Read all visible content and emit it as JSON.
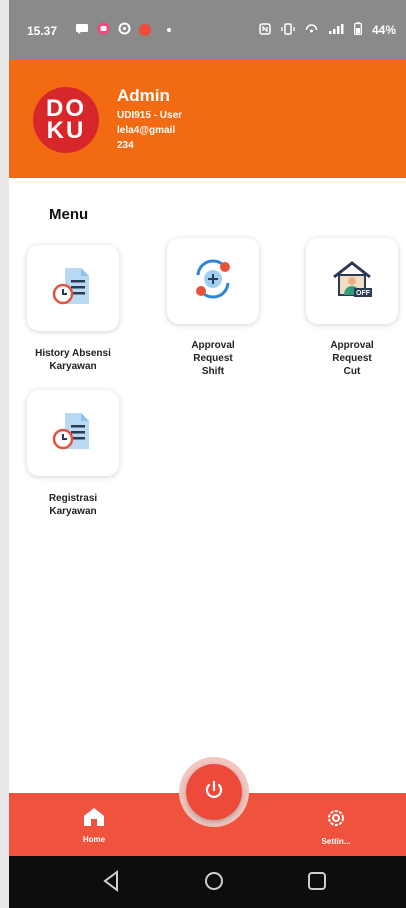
{
  "status_bar": {
    "time": "15.37",
    "battery": "44%",
    "icons_left": [
      "chat-bubble-icon",
      "notification-badge-icon",
      "sync-icon",
      "red-dot-icon",
      "small-dot-icon"
    ],
    "icons_right": [
      "nfc-icon",
      "vibrate-icon",
      "hotspot-icon",
      "signal-icon",
      "battery-icon"
    ]
  },
  "header": {
    "logo_line1": "DO",
    "logo_line2": "KU",
    "name": "Admin",
    "user_id": "UDI915 - User",
    "email": "lela4@gmail",
    "extra": "234",
    "background": "#f26a11"
  },
  "menu": {
    "title": "Menu",
    "items": [
      {
        "label_line1": "History Absensi",
        "label_line2": "Karyawan",
        "label_line3": "",
        "icon": "document-clock-icon"
      },
      {
        "label_line1": "Approval",
        "label_line2": "Request",
        "label_line3": "Shift",
        "icon": "shift-swap-icon"
      },
      {
        "label_line1": "Approval",
        "label_line2": "Request",
        "label_line3": "Cut",
        "icon": "leave-off-icon"
      },
      {
        "label_line1": "Registrasi",
        "label_line2": "Karyawan",
        "label_line3": "",
        "icon": "document-clock-icon"
      }
    ]
  },
  "bottom_nav": {
    "home_label": "Home",
    "settings_label": "Settin...",
    "power_icon": "power-icon",
    "background": "#f0533d"
  },
  "system_nav": {
    "icons": [
      "back-icon",
      "home-circle-icon",
      "recents-icon"
    ]
  }
}
